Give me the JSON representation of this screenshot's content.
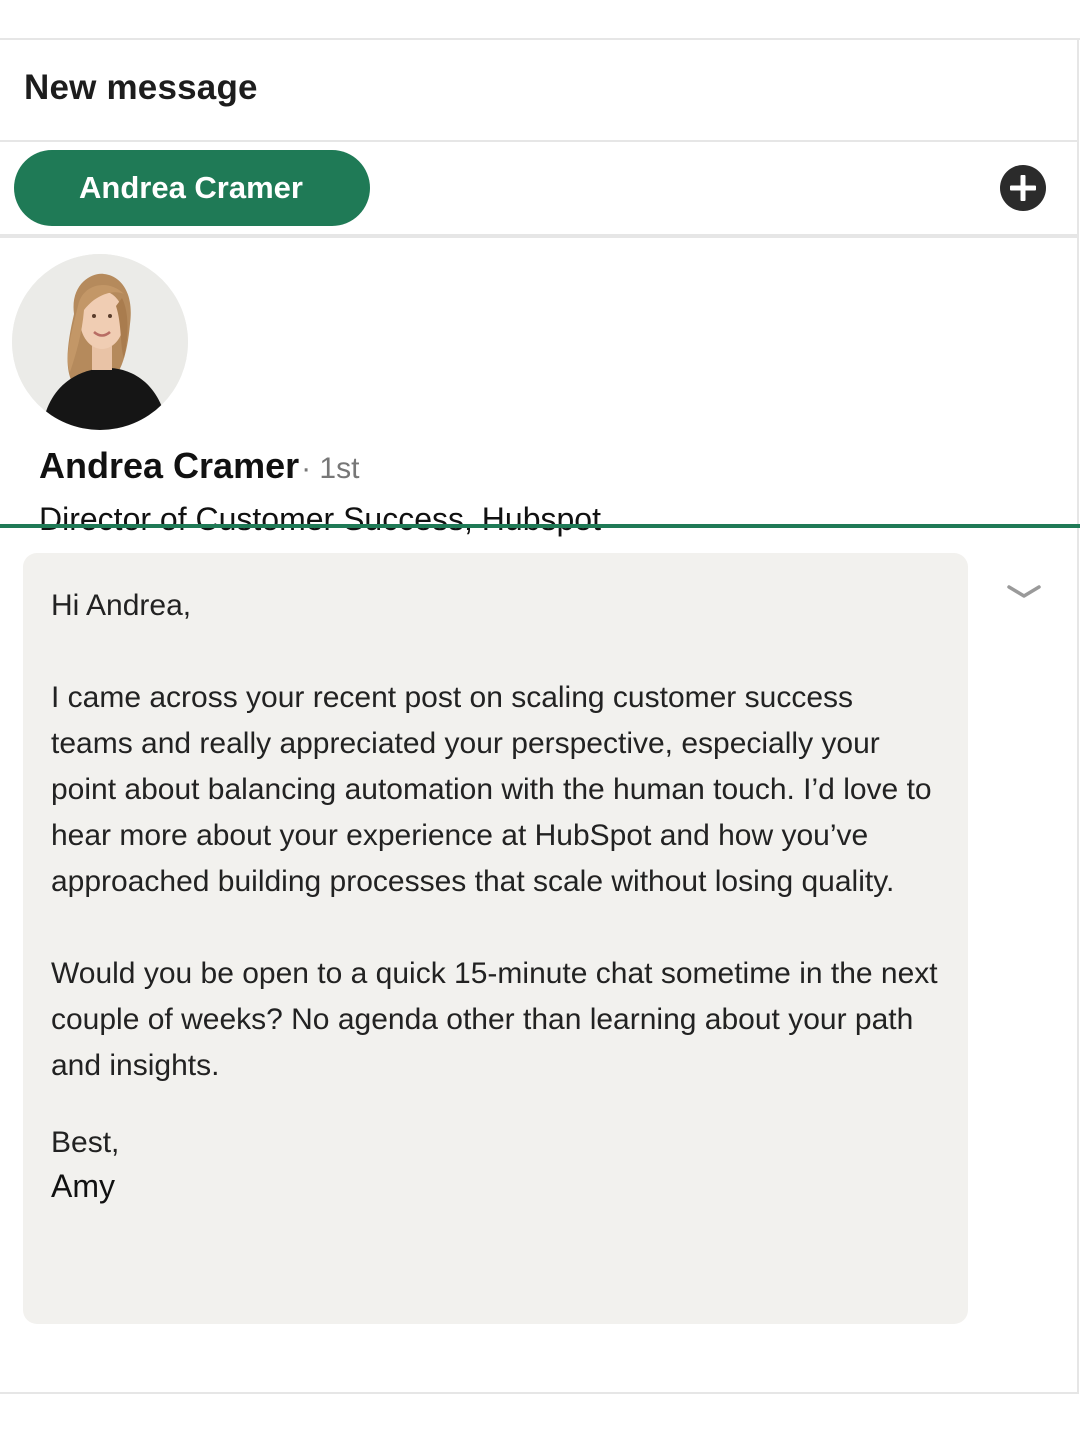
{
  "header": {
    "title": "New message"
  },
  "recipients": {
    "chips": [
      "Andrea Cramer"
    ],
    "add_icon": "plus-circle-icon"
  },
  "profile": {
    "name": "Andrea Cramer",
    "degree": "· 1st",
    "title": "Director of  Customer Success, Hubspot"
  },
  "message": {
    "greeting": "Hi Andrea,",
    "paragraph1": "I came across your recent post on scaling customer success teams and really appreciated your perspective, especially your point about balancing automation with the human touch. I’d love to hear more about your experience at HubSpot and how you’ve approached building processes that scale without losing quality.",
    "paragraph2": "Would you be open to a quick 15-minute chat sometime in the next couple of weeks? No agenda other than learning about your path and insights.",
    "signoff": "Best,",
    "signature": "Amy"
  },
  "colors": {
    "accent": "#1f7a56",
    "message_background": "#f2f1ee",
    "add_button": "#2b2b2b"
  },
  "icons": {
    "collapse": "chevron-down-icon"
  }
}
